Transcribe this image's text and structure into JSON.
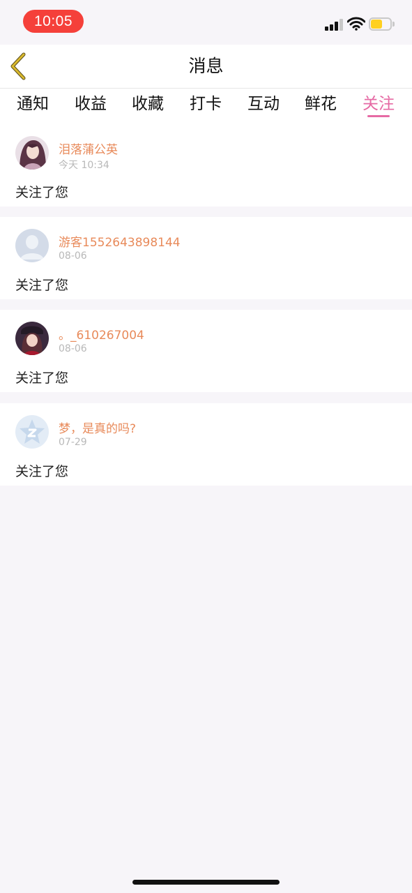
{
  "status_bar": {
    "time": "10:05",
    "icons": [
      "cellular-signal-icon",
      "wifi-icon",
      "battery-icon"
    ]
  },
  "header": {
    "back_icon": "chevron-left-icon",
    "title": "消息"
  },
  "tabs": [
    {
      "label": "通知",
      "active": false
    },
    {
      "label": "收益",
      "active": false
    },
    {
      "label": "收藏",
      "active": false
    },
    {
      "label": "打卡",
      "active": false
    },
    {
      "label": "互动",
      "active": false
    },
    {
      "label": "鲜花",
      "active": false
    },
    {
      "label": "关注",
      "active": true
    }
  ],
  "messages": [
    {
      "username": "泪落蒲公英",
      "date": "今天 10:34",
      "text": "关注了您",
      "avatar": "anime-girl-avatar"
    },
    {
      "username": "游客1552643898144",
      "date": "08-06",
      "text": "关注了您",
      "avatar": "default-person-avatar"
    },
    {
      "username": "。_610267004",
      "date": "08-06",
      "text": "关注了您",
      "avatar": "girl-photo-avatar"
    },
    {
      "username": "梦，是真的吗?",
      "date": "07-29",
      "text": "关注了您",
      "avatar": "qzone-star-avatar"
    }
  ],
  "colors": {
    "accent": "#e66aa4",
    "username": "#e88a5a",
    "back_arrow": "#c9a825",
    "time_pill": "#f5403a",
    "page_bg": "#f7f5f9"
  }
}
